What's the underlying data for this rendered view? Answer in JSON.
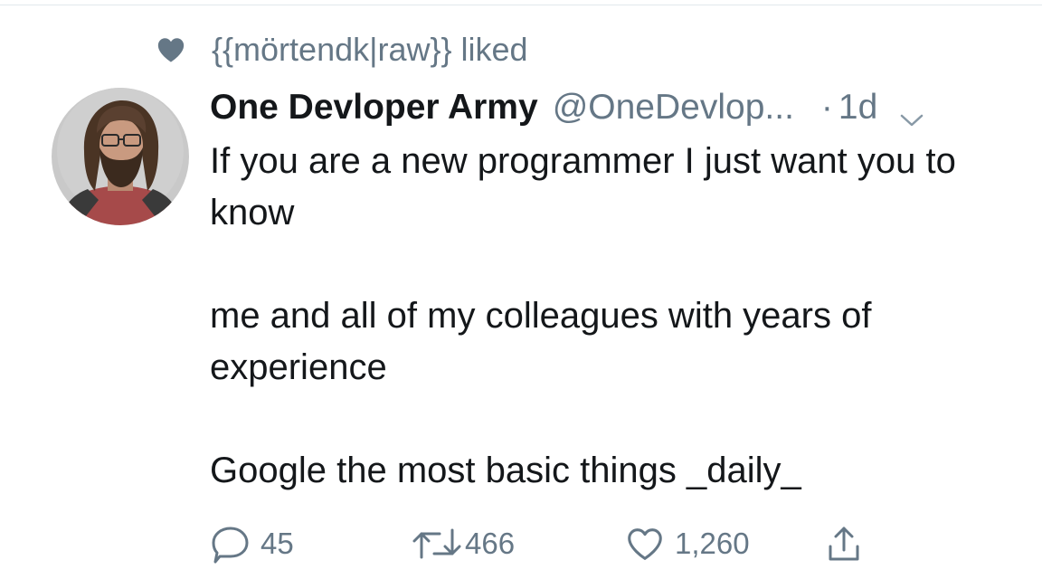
{
  "social_context": {
    "icon": "heart-filled-icon",
    "text": "{{mörtendk|raw}} liked"
  },
  "tweet": {
    "avatar_icon": "user-avatar-photo",
    "author_name": "One Devloper Army",
    "handle": "@OneDevlop...",
    "separator": "·",
    "time": "1d",
    "menu_icon": "chevron-down-icon",
    "text_lines": [
      "If you are a new programmer I just want you to know",
      "me and all of my colleagues with years of experience",
      "Google the most basic things _daily_"
    ]
  },
  "actions": {
    "reply": {
      "icon": "reply-bubble-icon",
      "count": "45"
    },
    "retweet": {
      "icon": "retweet-icon",
      "count": "466"
    },
    "like": {
      "icon": "heart-outline-icon",
      "count": "1,260"
    },
    "share": {
      "icon": "share-upload-icon"
    }
  },
  "colors": {
    "text": "#14171a",
    "muted": "#657786",
    "divider": "#e1e8ed",
    "background": "#ffffff"
  }
}
